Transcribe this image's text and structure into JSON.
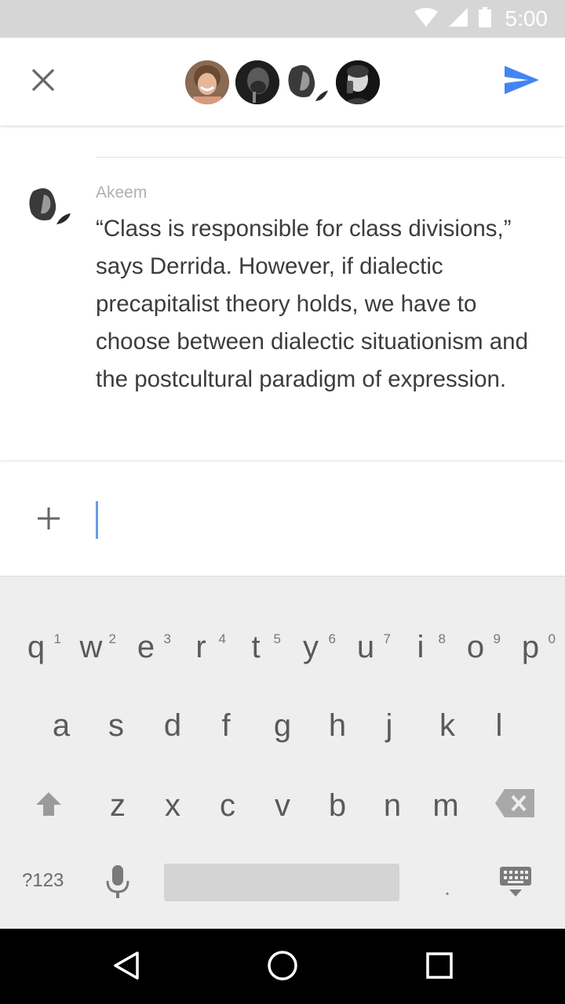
{
  "status_bar": {
    "time": "5:00"
  },
  "header": {
    "participants": [
      {
        "name_icon": "avatar-woman-smiling",
        "bg": "#c9a38a"
      },
      {
        "name_icon": "avatar-man-dark",
        "bg": "#2a2a2a"
      },
      {
        "name_icon": "avatar-profile-bw",
        "bg": "#dcdcdc"
      },
      {
        "name_icon": "avatar-man-phone",
        "bg": "#1f1f1f"
      }
    ],
    "accent": "#4285f4"
  },
  "message": {
    "sender": "Akeem",
    "text": "“Class is responsible for class divisions,” says Derrida. However, if dialectic precapitalist theory holds, we have to choose between dialectic situationism and the postcultural paradigm of expression."
  },
  "compose": {
    "value": "",
    "caret_color": "#6a9be8"
  },
  "keyboard": {
    "row1": [
      {
        "key": "q",
        "hint": "1"
      },
      {
        "key": "w",
        "hint": "2"
      },
      {
        "key": "e",
        "hint": "3"
      },
      {
        "key": "r",
        "hint": "4"
      },
      {
        "key": "t",
        "hint": "5"
      },
      {
        "key": "y",
        "hint": "6"
      },
      {
        "key": "u",
        "hint": "7"
      },
      {
        "key": "i",
        "hint": "8"
      },
      {
        "key": "o",
        "hint": "9"
      },
      {
        "key": "p",
        "hint": "0"
      }
    ],
    "row2": [
      "a",
      "s",
      "d",
      "f",
      "g",
      "h",
      "j",
      "k",
      "l"
    ],
    "row3": [
      "z",
      "x",
      "c",
      "v",
      "b",
      "n",
      "m"
    ],
    "symbols_label": "?123",
    "period": "."
  }
}
